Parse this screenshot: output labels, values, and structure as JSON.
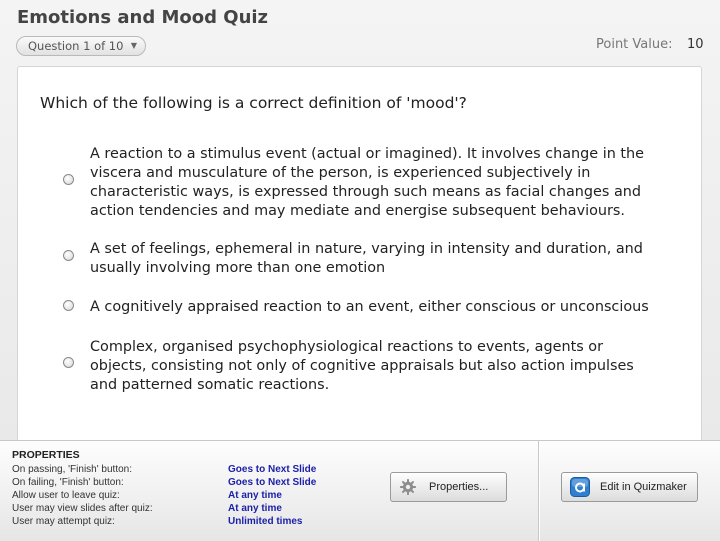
{
  "quiz": {
    "title": "Emotions and Mood Quiz",
    "question_selector": "Question 1 of 10",
    "point_label": "Point Value:",
    "point_value": "10",
    "question": "Which of the following is a correct definition of 'mood'?",
    "choices": [
      "A reaction to a stimulus event (actual or imagined). It involves change in the viscera and musculature of the person, is experienced subjectively in characteristic ways, is expressed through such means as facial changes and action tendencies and may mediate and energise subsequent behaviours.",
      "A set of feelings, ephemeral in nature, varying in intensity and duration, and usually involving more than one emotion",
      "A cognitively appraised reaction to an event, either conscious or unconscious",
      "Complex, organised psychophysiological reactions to events, agents or objects, consisting not only of cognitive appraisals but also action impulses and patterned somatic reactions."
    ]
  },
  "properties": {
    "title": "PROPERTIES",
    "rows": [
      {
        "label": "On passing, 'Finish' button:",
        "value": "Goes to Next Slide"
      },
      {
        "label": "On failing, 'Finish' button:",
        "value": "Goes to Next Slide"
      },
      {
        "label": "Allow user to leave quiz:",
        "value": "At any time"
      },
      {
        "label": "User may view slides after quiz:",
        "value": "At any time"
      },
      {
        "label": "User may attempt quiz:",
        "value": "Unlimited times"
      }
    ],
    "properties_button": "Properties...",
    "edit_button": "Edit in Quizmaker"
  }
}
